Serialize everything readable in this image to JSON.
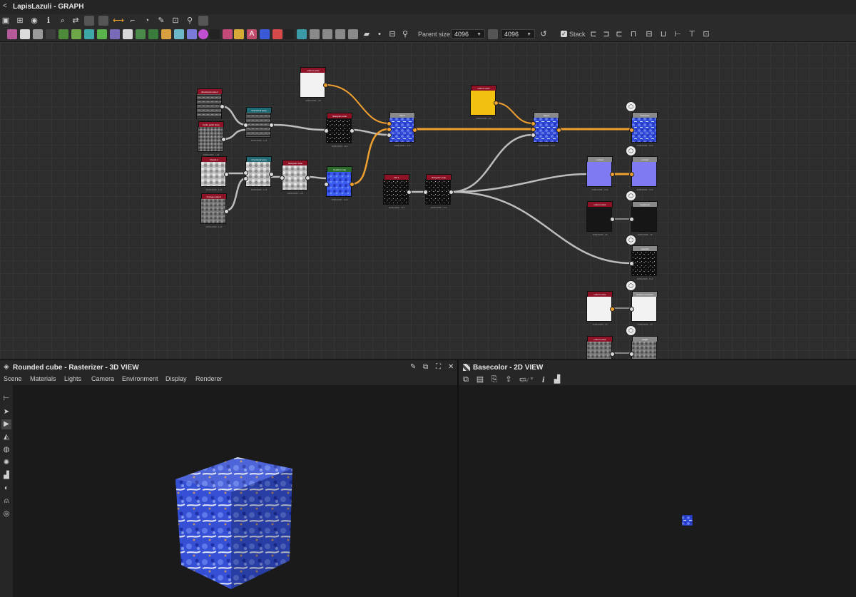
{
  "graph": {
    "title": "LapisLazuli - GRAPH",
    "toolbar": {
      "parent_size_label": "Parent size:",
      "parent_size_value": "4096",
      "output_size_value": "4096",
      "stack_label": "Stack"
    },
    "nodes": [
      {
        "id": "n1",
        "label": "directional noise 4",
        "size": "4096x4096 - L16",
        "color": "#8e1326",
        "tex": "rock"
      },
      {
        "id": "n2",
        "label": "Perlin perlin Grau",
        "size": "4096x4096 - L16",
        "color": "#8e1326",
        "tex": "rock2"
      },
      {
        "id": "n3",
        "label": "directional warp",
        "size": "4096x4096 - L16",
        "color": "#1f6a75",
        "tex": "rock"
      },
      {
        "id": "n4",
        "label": "uniform color",
        "size": "4096x4096 - C8",
        "color": "#8e1326",
        "tex": "white"
      },
      {
        "id": "n5",
        "label": "histogram scan",
        "size": "4096x4096 - L16",
        "color": "#8e1326",
        "tex": "dark"
      },
      {
        "id": "n6",
        "label": "blend",
        "size": "4096x4096 - C16",
        "color": "#8a8a8a",
        "tex": "lapis"
      },
      {
        "id": "n7",
        "label": "uniform color",
        "size": "4096x4096 - C8",
        "color": "#8e1326",
        "tex": "yellow"
      },
      {
        "id": "n8",
        "label": "blend",
        "size": "4096x4096 - C16",
        "color": "#8a8a8a",
        "tex": "lapis"
      },
      {
        "id": "n9",
        "label": "basecolor",
        "size": "4096x4096 - C16",
        "color": "#8a8a8a",
        "tex": "lapis"
      },
      {
        "id": "n10",
        "label": "Clouds 2",
        "size": "4096x4096 - L16",
        "color": "#8e1326",
        "tex": "cloud"
      },
      {
        "id": "n11",
        "label": "directional warp",
        "size": "4096x4096 - L16",
        "color": "#1f6a75",
        "tex": "cloud"
      },
      {
        "id": "n12",
        "label": "histogram scan",
        "size": "4096x4096 - L16",
        "color": "#8e1326",
        "tex": "cloud"
      },
      {
        "id": "n13",
        "label": "Gradient map",
        "size": "4096x4096 - C16",
        "color": "#2b6b2b",
        "tex": "lapis2"
      },
      {
        "id": "n14",
        "label": "Dirt 1",
        "size": "4096x4096 - L16",
        "color": "#8e1326",
        "tex": "dark"
      },
      {
        "id": "n15",
        "label": "Grunge maps 2",
        "size": "4096x4096 - L16",
        "color": "#8e1326",
        "tex": "grey"
      },
      {
        "id": "n16",
        "label": "histogram scan",
        "size": "4096x4096 - L16",
        "color": "#8e1326",
        "tex": "dark"
      },
      {
        "id": "n17",
        "label": "normal",
        "size": "4096x4096 - C16",
        "color": "#8a8a8a",
        "tex": "purple"
      },
      {
        "id": "n18",
        "label": "normal",
        "size": "4096x4096 - C16",
        "color": "#8a8a8a",
        "tex": "purple"
      },
      {
        "id": "n19",
        "label": "uniform color",
        "size": "4096x4096 - L8",
        "color": "#8e1326",
        "tex": "black"
      },
      {
        "id": "n20",
        "label": "roughness",
        "size": "4096x4096 - L8",
        "color": "#8a8a8a",
        "tex": "black"
      },
      {
        "id": "n21",
        "label": "specular",
        "size": "4096x4096 - L16",
        "color": "#8a8a8a",
        "tex": "dark"
      },
      {
        "id": "n22",
        "label": "uniform color",
        "size": "4096x4096 - L8",
        "color": "#8e1326",
        "tex": "white"
      },
      {
        "id": "n23",
        "label": "ambient occlusion",
        "size": "4096x4096 - L8",
        "color": "#8a8a8a",
        "tex": "white"
      },
      {
        "id": "n24",
        "label": "uniform color",
        "size": "",
        "color": "#8e1326",
        "tex": "grey"
      },
      {
        "id": "n25",
        "label": "height",
        "size": "",
        "color": "#8a8a8a",
        "tex": "grey"
      }
    ]
  },
  "view3d": {
    "title": "Rounded cube - Rasterizer - 3D VIEW",
    "menu": [
      "Scene",
      "Materials",
      "Lights",
      "Camera",
      "Environment",
      "Display",
      "Renderer"
    ]
  },
  "view2d": {
    "title": "Basecolor - 2D VIEW",
    "uv_label": "UV",
    "info_label": "i"
  },
  "colors": {
    "accent_orange": "#f0a030",
    "lapis_blue": "#3a55d8",
    "node_red": "#8e1326",
    "node_teal": "#1f6a75"
  }
}
